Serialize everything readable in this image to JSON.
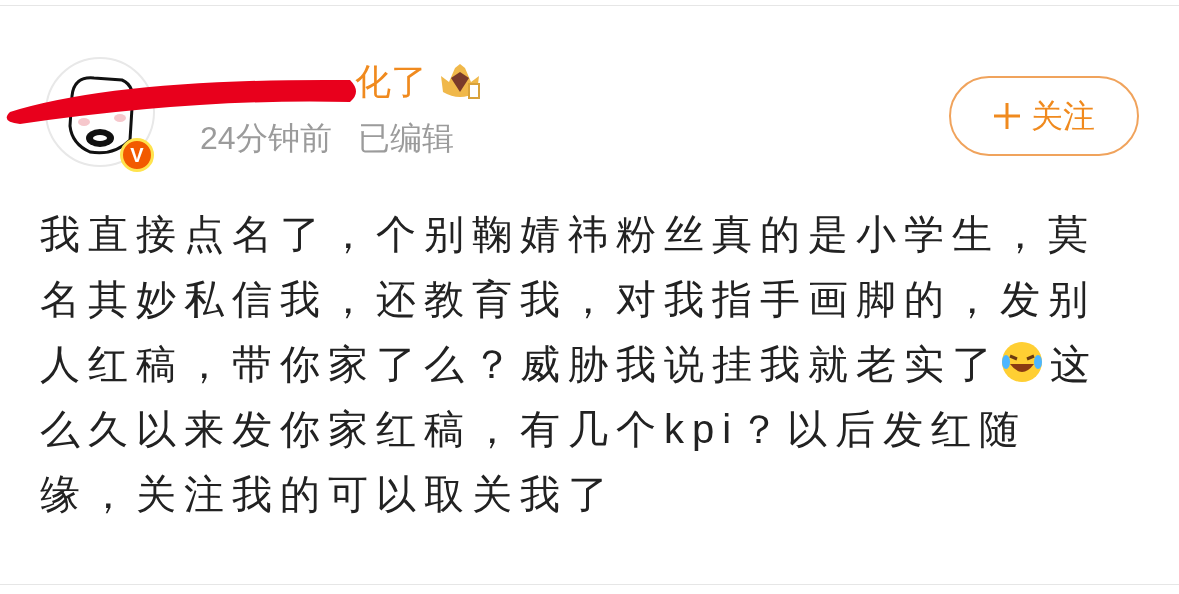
{
  "post": {
    "author": {
      "name": "化了",
      "badge": "V"
    },
    "meta": [
      "24分钟前",
      "已编辑"
    ],
    "follow_button": "关注",
    "content": [
      {
        "kind": "text",
        "text": "我直接点名了，个别鞠婧祎粉丝真的是小学生，莫名其妙私信我，还教育我，对我指手画脚的，发别人红稿，带你家了么？威胁我说挂我就老实了"
      },
      {
        "kind": "emoji"
      },
      {
        "kind": "text",
        "text": "这么久以来发你家红稿，有几个kpi？以后发红随缘，关注我的可以取关我了"
      }
    ]
  }
}
